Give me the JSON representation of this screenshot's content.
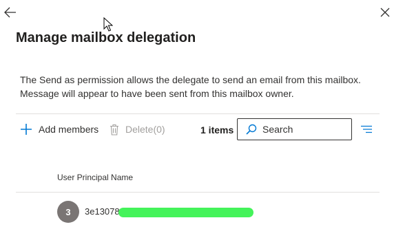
{
  "header": {
    "back_icon": "arrow-left-icon",
    "close_icon": "close-icon",
    "title": "Manage mailbox delegation"
  },
  "description": "The Send as permission allows the delegate to send an email from this mailbox. Message will appear to have been sent from this mailbox owner.",
  "toolbar": {
    "add_label": "Add members",
    "add_icon": "plus-icon",
    "delete_label": "Delete(0)",
    "delete_icon": "trash-icon",
    "items_count": "1 items",
    "search": {
      "value": "",
      "placeholder": "Search",
      "icon": "search-icon"
    },
    "filter_icon": "filter-icon"
  },
  "table": {
    "columns": [
      "User Principal Name"
    ],
    "rows": [
      {
        "avatar_initial": "3",
        "upn": "3e13078c"
      }
    ]
  },
  "colors": {
    "accent": "#0078d4",
    "avatar_bg": "#7a7574",
    "redaction": "#44f35a",
    "disabled_text": "#a19f9d"
  }
}
